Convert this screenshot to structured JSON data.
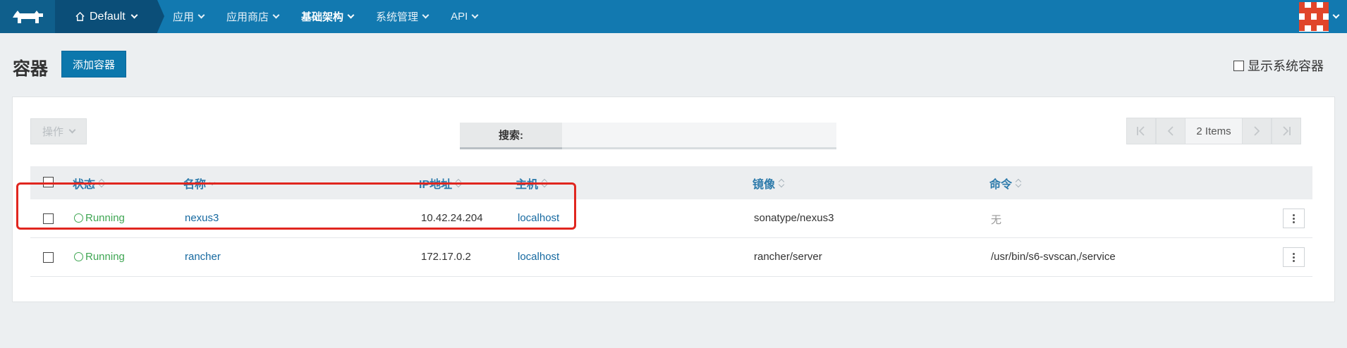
{
  "topbar": {
    "env_label": "Default",
    "nav": [
      {
        "label": "应用"
      },
      {
        "label": "应用商店"
      },
      {
        "label": "基础架构"
      },
      {
        "label": "系统管理"
      },
      {
        "label": "API"
      }
    ]
  },
  "page": {
    "title": "容器",
    "add_button": "添加容器",
    "show_system_label": "显示系统容器"
  },
  "toolbar": {
    "ops_label": "操作",
    "search_label": "搜索:",
    "search_value": "",
    "pager_count": "2 Items"
  },
  "table": {
    "headers": {
      "state": "状态",
      "name": "名称",
      "ip": "IP地址",
      "host": "主机",
      "image": "镜像",
      "command": "命令"
    },
    "rows": [
      {
        "state": "Running",
        "name": "nexus3",
        "ip": "10.42.24.204",
        "host": "localhost",
        "image": "sonatype/nexus3",
        "command": "无"
      },
      {
        "state": "Running",
        "name": "rancher",
        "ip": "172.17.0.2",
        "host": "localhost",
        "image": "rancher/server",
        "command": "/usr/bin/s6-svscan,/service"
      }
    ]
  },
  "colors": {
    "nav_bg": "#1279b0",
    "accent": "#0c77ac",
    "running": "#3fa653",
    "highlight": "#e0261f"
  }
}
